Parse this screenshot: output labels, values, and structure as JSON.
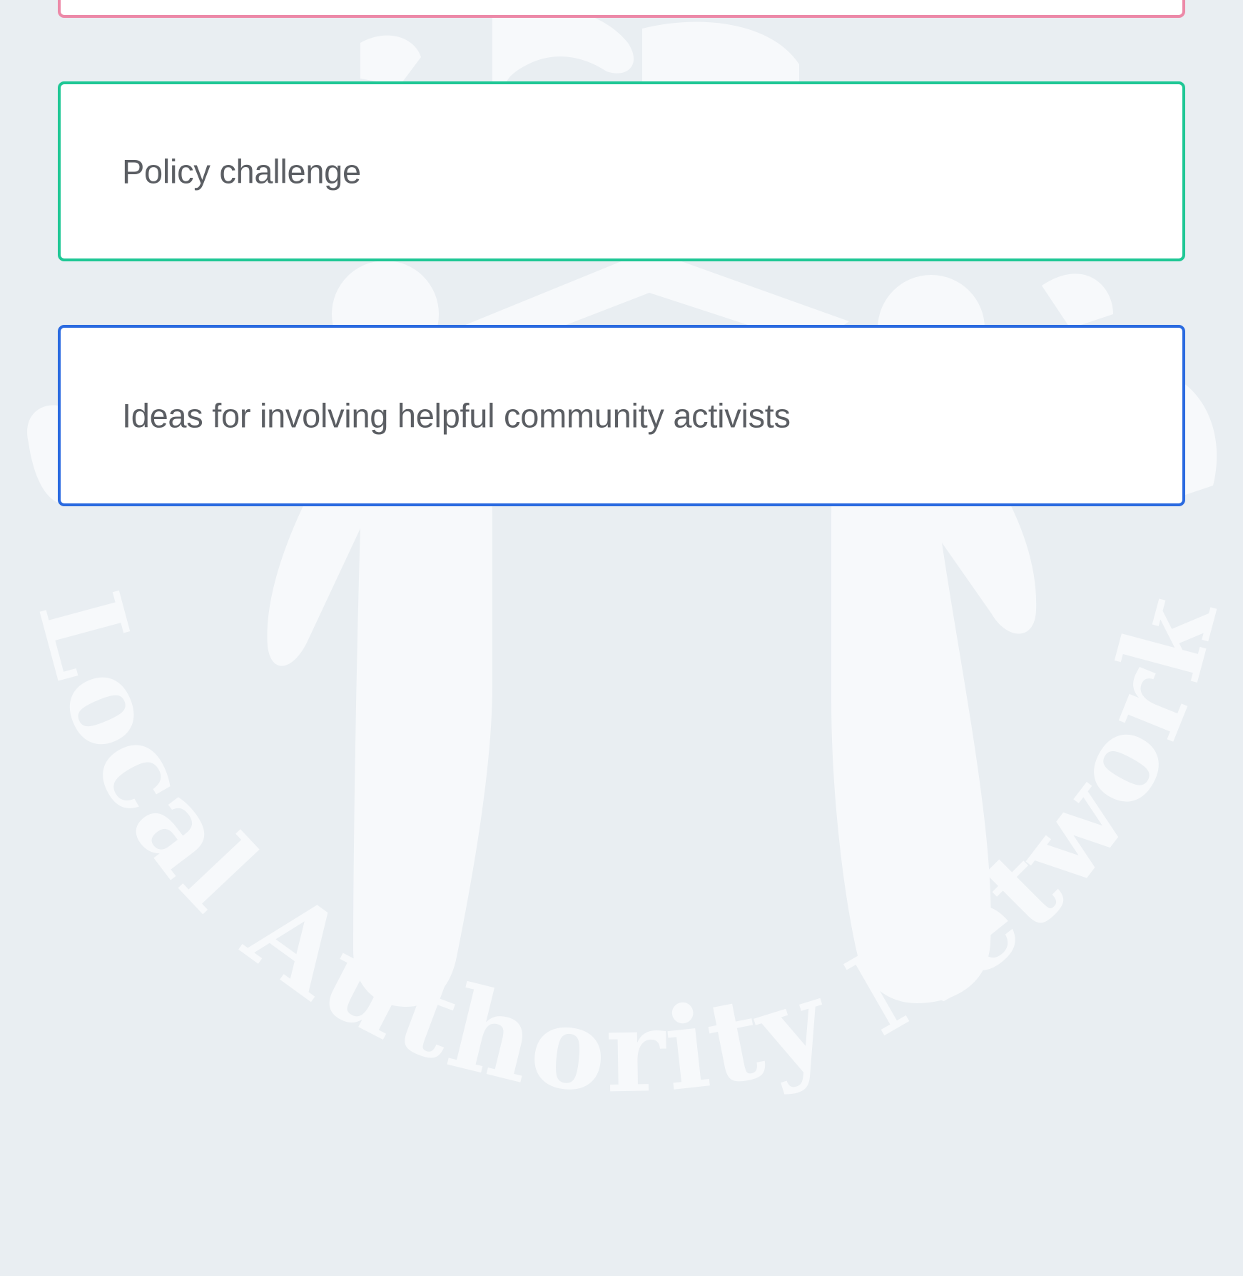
{
  "colors": {
    "background": "#e9eef2",
    "watermark": "#f7f9fb",
    "card_pink_border": "#ec89a8",
    "card_green_border": "#1fc795",
    "card_blue_border": "#2a6ae0",
    "card_text": "#5b5e63"
  },
  "watermark": {
    "arc_text": "Local Authority Network"
  },
  "cards": [
    {
      "label": ""
    },
    {
      "label": "Policy challenge"
    },
    {
      "label": "Ideas for involving helpful community activists"
    }
  ]
}
